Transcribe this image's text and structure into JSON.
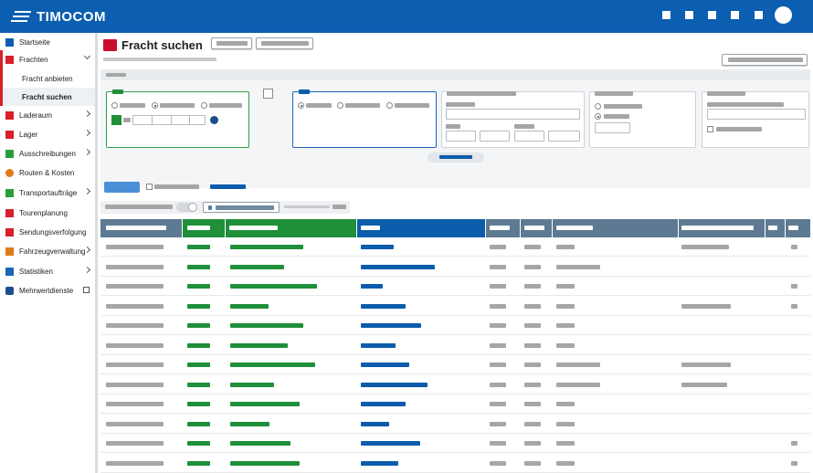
{
  "app": {
    "brand": "TIMOCOM"
  },
  "colors": {
    "brand_blue": "#0b5eb0",
    "accent_red": "#c8102e",
    "green": "#1f8f3a",
    "blue": "#0b5cab",
    "header_gray": "#5e7a92"
  },
  "sidebar": {
    "items": [
      {
        "label": "Startseite",
        "icon": "home-icon",
        "chevron": ""
      },
      {
        "label": "Frachten",
        "icon": "freight-icon",
        "chevron": "down"
      },
      {
        "label": "Laderaum",
        "icon": "truck-icon",
        "chevron": "right"
      },
      {
        "label": "Lager",
        "icon": "warehouse-icon",
        "chevron": "right"
      },
      {
        "label": "Ausschreibungen",
        "icon": "gavel-icon",
        "chevron": "right"
      },
      {
        "label": "Routen & Kosten",
        "icon": "route-icon",
        "chevron": ""
      },
      {
        "label": "Transportaufträge",
        "icon": "order-icon",
        "chevron": "right"
      },
      {
        "label": "Tourenplanung",
        "icon": "tour-icon",
        "chevron": ""
      },
      {
        "label": "Sendungsverfolgung",
        "icon": "tracking-icon",
        "chevron": ""
      },
      {
        "label": "Fahrzeugverwaltung",
        "icon": "fleet-icon",
        "chevron": "right"
      },
      {
        "label": "Statistiken",
        "icon": "chart-icon",
        "chevron": "right"
      },
      {
        "label": "Mehrwertdienste",
        "icon": "services-icon",
        "chevron": "external"
      }
    ],
    "subitems": [
      {
        "label": "Fracht anbieten",
        "active": false
      },
      {
        "label": "Fracht suchen",
        "active": true
      }
    ]
  },
  "page": {
    "title": "Fracht suchen"
  }
}
